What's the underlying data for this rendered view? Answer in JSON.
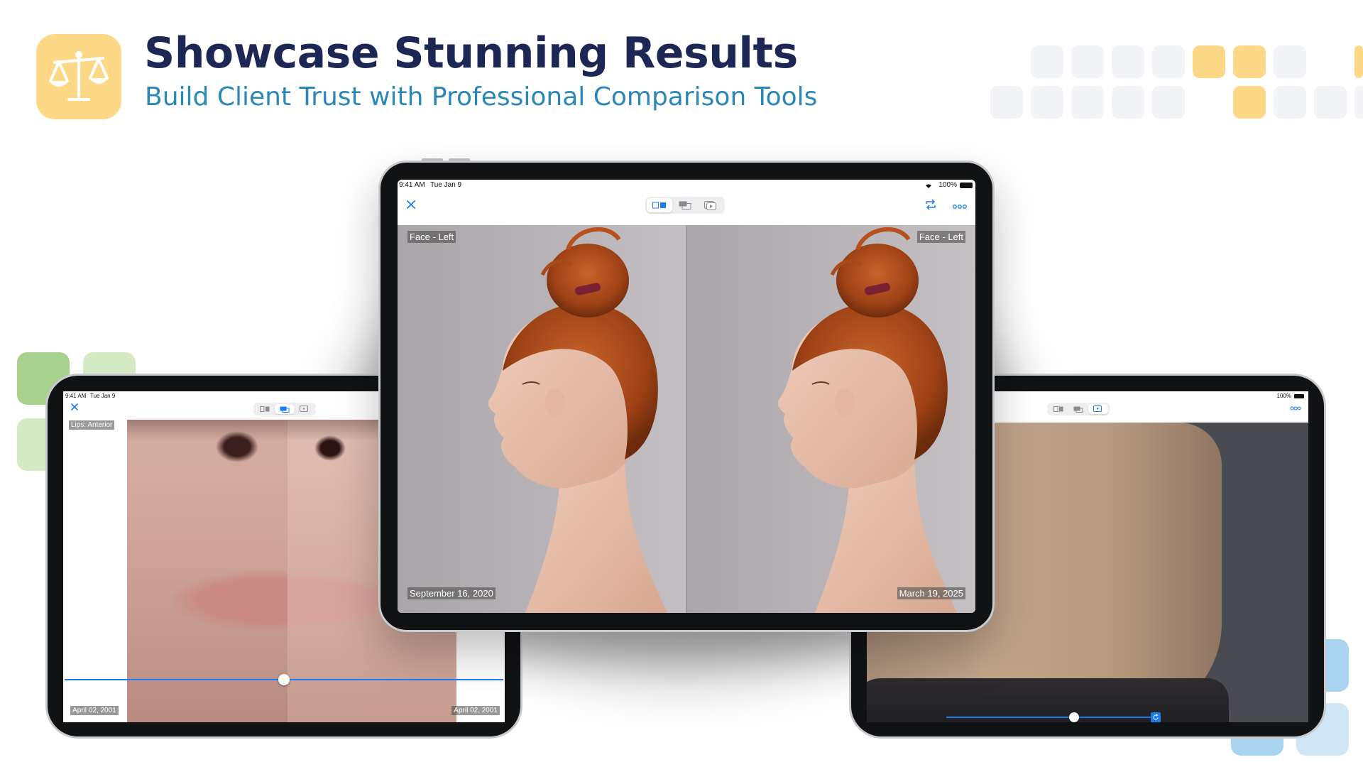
{
  "header": {
    "title": "Showcase Stunning Results",
    "subtitle": "Build Client Trust with Professional Comparison Tools",
    "app_icon": "scales-icon"
  },
  "colors": {
    "title": "#1c2755",
    "subtitle": "#2a87b6",
    "app_icon_bg": "#fdd987",
    "accent_blue": "#1a7cf2",
    "deco_yellow": "#fdd987",
    "deco_grey": "#f3f4f8",
    "deco_green_dark": "#a9d18e",
    "deco_green_light": "#d5e9c5",
    "deco_blue": "#a9d3ee"
  },
  "center_ipad": {
    "status": {
      "time": "9:41 AM",
      "date": "Tue Jan 9",
      "battery": "100%"
    },
    "toolbar": {
      "close_icon": "close-icon",
      "modes": [
        "side-by-side-icon",
        "overlay-slider-icon",
        "slideshow-icon"
      ],
      "active_mode": 0,
      "rotate_icon": "rotate-icon",
      "more_icon": "more-icon"
    },
    "left_photo": {
      "label": "Face - Left",
      "date": "September 16, 2020"
    },
    "right_photo": {
      "label": "Face - Left",
      "date": "March 19, 2025"
    }
  },
  "left_ipad": {
    "status": {
      "time": "9:41 AM",
      "date": "Tue Jan 9"
    },
    "active_mode": 1,
    "photo_label": "Lips: Anterior",
    "left_date": "April 02, 2001",
    "right_date": "April 02, 2001",
    "slider_position": 0.5
  },
  "right_ipad": {
    "status": {
      "battery": "100%"
    },
    "active_mode": 2,
    "slider_position": 0.6
  }
}
